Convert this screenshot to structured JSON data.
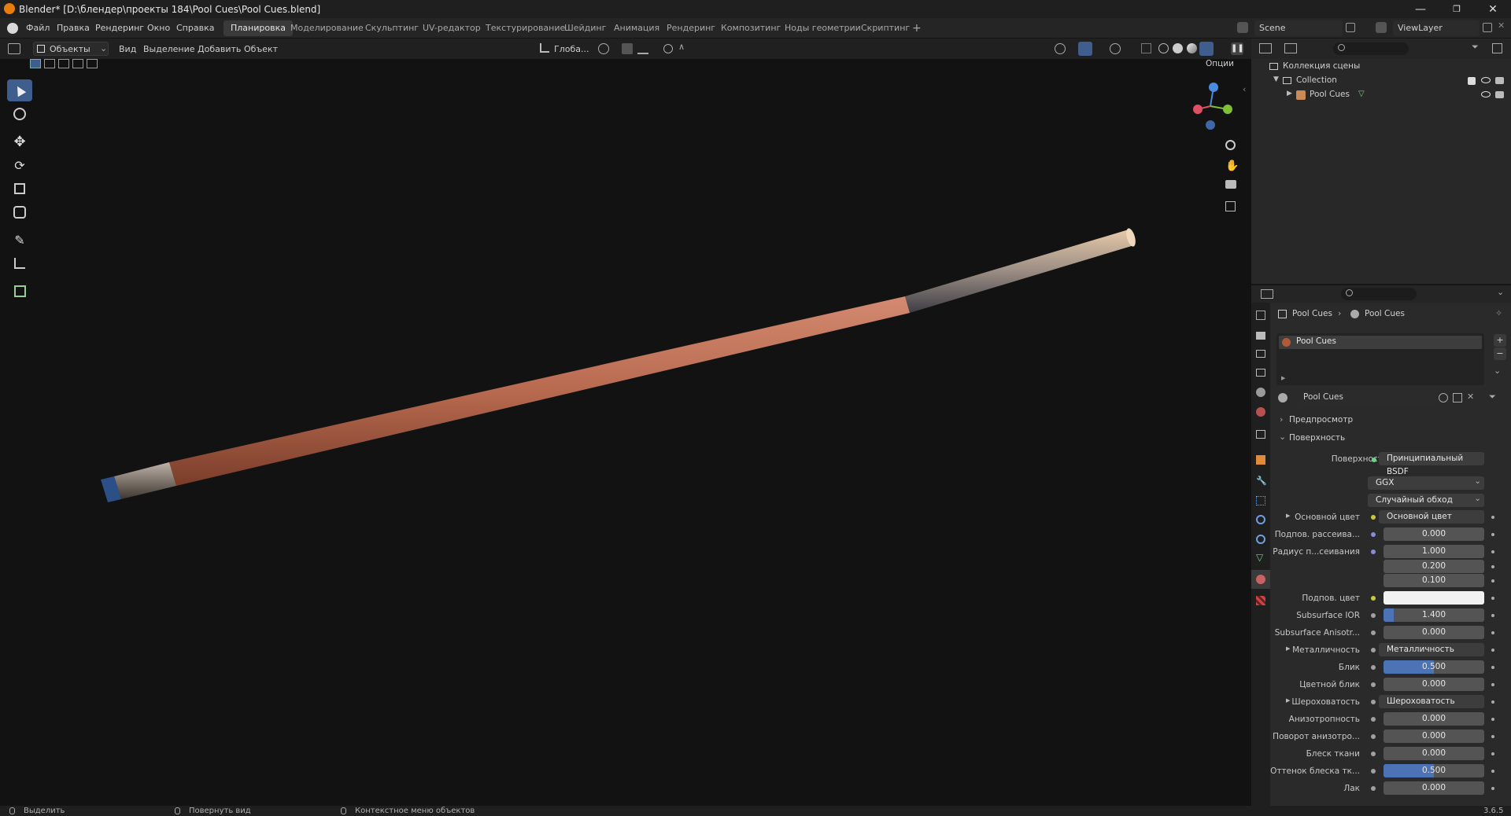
{
  "titlebar": {
    "title": "Blender* [D:\\блендер\\проекты 184\\Pool Cues\\Pool Cues.blend]"
  },
  "menu": [
    "Файл",
    "Правка",
    "Рендеринг",
    "Окно",
    "Справка"
  ],
  "workspaces": [
    "Планировка",
    "Моделирование",
    "Скульптинг",
    "UV-редактор",
    "Текстурирование",
    "Шейдинг",
    "Анимация",
    "Рендеринг",
    "Композитинг",
    "Ноды геометрии",
    "Скриптинг"
  ],
  "active_workspace": "Планировка",
  "scene": {
    "label": "Scene",
    "viewlayer": "ViewLayer"
  },
  "viewport_header": {
    "mode": "Объекты",
    "menus": [
      "Вид",
      "Выделение",
      "Добавить",
      "Объект"
    ],
    "transform": "Глоба...",
    "options": "Опции"
  },
  "outliner": {
    "scene_collection": "Коллекция сцены",
    "collection": "Collection",
    "object": "Pool Cues"
  },
  "properties": {
    "breadcrumb": [
      "Pool Cues",
      "Pool Cues"
    ],
    "material_slot": "Pool Cues",
    "material_name": "Pool Cues",
    "panel_preview": "Предпросмотр",
    "panel_surface": "Поверхность",
    "surface_label": "Поверхность",
    "surface_value": "Принципиальный BSDF",
    "distribution": "GGX",
    "subsurface_method": "Случайный обход",
    "rows": [
      {
        "label": "Основной цвет",
        "value": "Основной цвет",
        "kind": "link",
        "dot": "#c8c83a",
        "expand": true
      },
      {
        "label": "Подпов. рассеива...",
        "value": "0.000",
        "kind": "num",
        "dot": "#8a8ad6"
      },
      {
        "label": "Радиус п...сеивания",
        "value": "1.000",
        "kind": "num",
        "dot": "#8a8ad6"
      },
      {
        "label": "",
        "value": "0.200",
        "kind": "num",
        "dot": ""
      },
      {
        "label": "",
        "value": "0.100",
        "kind": "num",
        "dot": ""
      },
      {
        "label": "Подпов. цвет",
        "value": "",
        "kind": "color",
        "dot": "#c8c83a"
      },
      {
        "label": "Subsurface IOR",
        "value": "1.400",
        "kind": "ior",
        "dot": "#a0a0a0"
      },
      {
        "label": "Subsurface Anisotr...",
        "value": "0.000",
        "kind": "num",
        "dot": "#a0a0a0"
      },
      {
        "label": "Металличность",
        "value": "Металличность",
        "kind": "link",
        "dot": "#a0a0a0",
        "expand": true
      },
      {
        "label": "Блик",
        "value": "0.500",
        "kind": "fill",
        "dot": "#a0a0a0"
      },
      {
        "label": "Цветной блик",
        "value": "0.000",
        "kind": "num",
        "dot": "#a0a0a0"
      },
      {
        "label": "Шероховатость",
        "value": "Шероховатость",
        "kind": "link",
        "dot": "#a0a0a0",
        "expand": true
      },
      {
        "label": "Анизотропность",
        "value": "0.000",
        "kind": "num",
        "dot": "#a0a0a0"
      },
      {
        "label": "Поворот анизотро...",
        "value": "0.000",
        "kind": "num",
        "dot": "#a0a0a0"
      },
      {
        "label": "Блеск ткани",
        "value": "0.000",
        "kind": "num",
        "dot": "#a0a0a0"
      },
      {
        "label": "Оттенок блеска тк...",
        "value": "0.500",
        "kind": "fill",
        "dot": "#a0a0a0"
      },
      {
        "label": "Лак",
        "value": "0.000",
        "kind": "num",
        "dot": "#a0a0a0"
      }
    ]
  },
  "statusbar": {
    "select": "Выделить",
    "rotate": "Повернуть вид",
    "context": "Контекстное меню объектов",
    "version": "3.6.5"
  }
}
